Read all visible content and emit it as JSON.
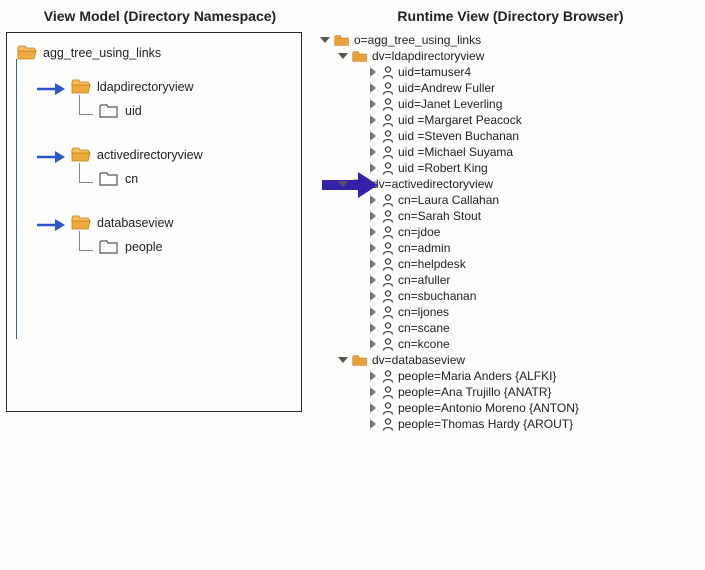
{
  "left": {
    "title": "View Model (Directory Namespace)",
    "root": "agg_tree_using_links",
    "children": [
      {
        "name": "ldapdirectoryview",
        "child": "uid"
      },
      {
        "name": "activedirectoryview",
        "child": "cn"
      },
      {
        "name": "databaseview",
        "child": "people"
      }
    ]
  },
  "right": {
    "title": "Runtime View (Directory Browser)",
    "root": "o=agg_tree_using_links",
    "groups": [
      {
        "label": "dv=ldapdirectoryview",
        "rows": [
          "uid=tamuser4",
          "uid=Andrew Fuller",
          "uid=Janet Leverling",
          "uid =Margaret Peacock",
          "uid =Steven Buchanan",
          "uid =Michael Suyama",
          "uid =Robert King"
        ]
      },
      {
        "label": "dv=activedirectoryview",
        "rows": [
          "cn=Laura Callahan",
          "cn=Sarah Stout",
          "cn=jdoe",
          "cn=admin",
          "cn=helpdesk",
          "cn=afuller",
          "cn=sbuchanan",
          "cn=ljones",
          "cn=scane",
          "cn=kcone"
        ]
      },
      {
        "label": "dv=databaseview",
        "rows": [
          "people=Maria Anders {ALFKI}",
          "people=Ana Trujillo {ANATR}",
          "people=Antonio Moreno {ANTON}",
          "people=Thomas Hardy {AROUT}"
        ]
      }
    ]
  }
}
